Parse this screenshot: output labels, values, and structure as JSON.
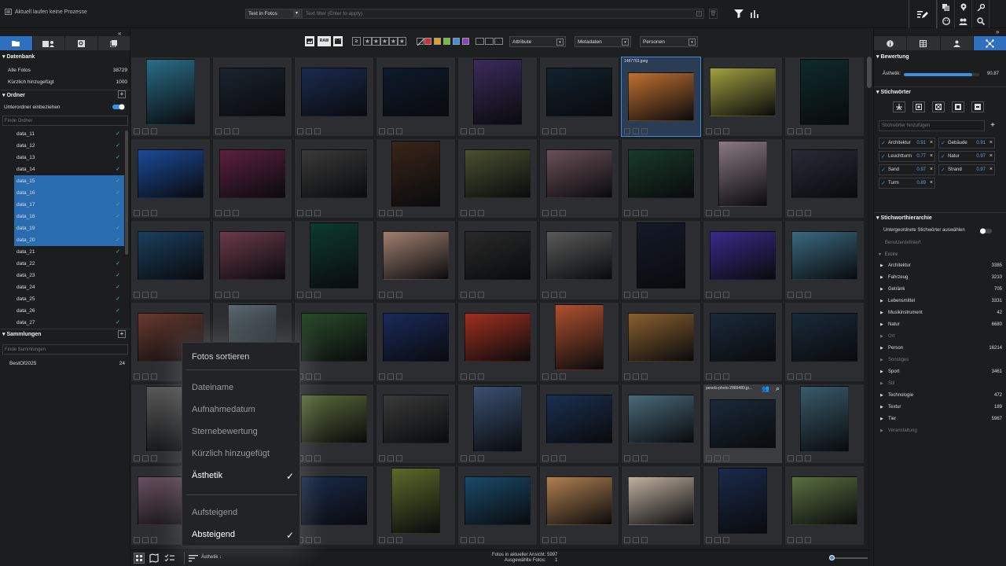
{
  "topbar": {
    "status": "Aktuell laufen keine Prozesse",
    "search_scope": "Text in Fotos",
    "search_placeholder": "Text filter (Enter to apply)"
  },
  "sidebar": {
    "database_title": "Datenbank",
    "all_photos_label": "Alle Fotos",
    "all_photos_count": "38729",
    "recent_label": "Kürzlich hinzugefügt",
    "recent_count": "1000",
    "folders_title": "Ordner",
    "include_subfolders": "Unterordner einbeziehen",
    "folder_search_placeholder": "Finde Ordner",
    "folders": [
      {
        "name": "data_11",
        "sel": false
      },
      {
        "name": "data_12",
        "sel": false
      },
      {
        "name": "data_13",
        "sel": false
      },
      {
        "name": "data_14",
        "sel": false
      },
      {
        "name": "data_15",
        "sel": true
      },
      {
        "name": "data_16",
        "sel": true
      },
      {
        "name": "data_17",
        "sel": true
      },
      {
        "name": "data_18",
        "sel": true
      },
      {
        "name": "data_19",
        "sel": true
      },
      {
        "name": "data_20",
        "sel": true
      },
      {
        "name": "data_21",
        "sel": false
      },
      {
        "name": "data_22",
        "sel": false
      },
      {
        "name": "data_23",
        "sel": false
      },
      {
        "name": "data_24",
        "sel": false
      },
      {
        "name": "data_25",
        "sel": false
      },
      {
        "name": "data_26",
        "sel": false
      },
      {
        "name": "data_27",
        "sel": false
      }
    ],
    "collections_title": "Sammlungen",
    "collection_search_placeholder": "Finde Sammlungen",
    "collection_name": "BestOf2025",
    "collection_count": "24"
  },
  "gridtoolbar": {
    "raw_label": "RAW",
    "gte_label": "≥",
    "attribute_label": "Attribute",
    "metadata_label": "Metadaten",
    "persons_label": "Personen",
    "color_labels": [
      "#d03030",
      "#e0a020",
      "#70c030",
      "#3a8fe0",
      "#8a40c0"
    ]
  },
  "grid": {
    "selected_caption": "1487763.jpeg",
    "hover_caption": "pexels-photo-2889489.jp..."
  },
  "bottombar": {
    "sort_label": "Ästhetik",
    "count_view_label": "Fotos in aktueller Ansicht:",
    "count_view": "5997",
    "count_selected_label": "Ausgewählte Fotos:",
    "count_selected": "1"
  },
  "rightpanel": {
    "rating_title": "Bewertung",
    "aesthetic_label": "Ästhetik:",
    "aesthetic_value": "90.87",
    "aesthetic_fraction": 0.9087,
    "keywords_title": "Stichwörter",
    "keyword_input_placeholder": "Stichwörter hinzufügen",
    "keywords": [
      {
        "name": "Architektur",
        "score": "0.91"
      },
      {
        "name": "Gebäude",
        "score": "0.91"
      },
      {
        "name": "Leuchtturm",
        "score": "0.77"
      },
      {
        "name": "Natur",
        "score": "0.97"
      },
      {
        "name": "Sand",
        "score": "0.97"
      },
      {
        "name": "Strand",
        "score": "0.97"
      },
      {
        "name": "Turm",
        "score": "0.89"
      }
    ],
    "hierarchy_title": "Stichworthierarchie",
    "show_sub_label": "Untergeordnete Stichwörter auswählen",
    "custom_label": "Benutzerdefiniert",
    "excire_label": "Excire",
    "hierarchy": [
      {
        "name": "Architektur",
        "count": "3385",
        "dim": false
      },
      {
        "name": "Fahrzeug",
        "count": "3210",
        "dim": false
      },
      {
        "name": "Getränk",
        "count": "705",
        "dim": false
      },
      {
        "name": "Lebensmittel",
        "count": "3331",
        "dim": false
      },
      {
        "name": "Musikinstrument",
        "count": "42",
        "dim": false
      },
      {
        "name": "Natur",
        "count": "6680",
        "dim": false
      },
      {
        "name": "Ort",
        "count": "",
        "dim": true
      },
      {
        "name": "Person",
        "count": "16214",
        "dim": false
      },
      {
        "name": "Sonstiges",
        "count": "",
        "dim": true
      },
      {
        "name": "Sport",
        "count": "3461",
        "dim": false
      },
      {
        "name": "Stil",
        "count": "",
        "dim": true
      },
      {
        "name": "Technologie",
        "count": "472",
        "dim": false
      },
      {
        "name": "Textur",
        "count": "189",
        "dim": false
      },
      {
        "name": "Tier",
        "count": "5967",
        "dim": false
      },
      {
        "name": "Veranstaltung",
        "count": "",
        "dim": true
      }
    ]
  },
  "sortmenu": {
    "title": "Fotos sortieren",
    "options": [
      {
        "label": "Dateiname",
        "checked": false
      },
      {
        "label": "Aufnahmedatum",
        "checked": false
      },
      {
        "label": "Sternebewertung",
        "checked": false
      },
      {
        "label": "Kürzlich hinzugefügt",
        "checked": false
      },
      {
        "label": "Ästhetik",
        "checked": true
      }
    ],
    "orders": [
      {
        "label": "Aufsteigend",
        "checked": false
      },
      {
        "label": "Absteigend",
        "checked": true
      }
    ]
  },
  "thumbs": [
    [
      "#2b6d88",
      "#1b2430",
      "#1a2b50",
      "#0e1b2c",
      "#3b2b5c",
      "#12222e",
      "#c07030",
      "#a0a040",
      "#0f2a2a"
    ],
    [
      "#1b4a9a",
      "#5b2040",
      "#3a3a3a",
      "#3a2518",
      "#4a5030",
      "#6a5058",
      "#1a3a2a",
      "#8a7a80",
      "#2a2a38"
    ],
    [
      "#1b3e5e",
      "#6b3a4a",
      "#0e3a2e",
      "#a08070",
      "#2a2a2a",
      "#5a5a5a",
      "#151a2a",
      "#3a2a8a",
      "#3a6a80"
    ],
    [
      "#6a3a30",
      "#5a6a70",
      "#2a4a2a",
      "#1a2a5a",
      "#a03020",
      "#b05030",
      "#8a6030",
      "#1a2a3a",
      "#1a2a3a"
    ],
    [
      "#5a5a5a",
      "#4a4a4a",
      "#5a6a3a",
      "#3a3a3a",
      "#3a5070",
      "#1a3050",
      "#4a6a7a",
      "#1a2a3a",
      "#3a5a6a"
    ],
    [
      "#6a5060",
      "#2a2a2a",
      "#1a2a4a",
      "#5a6a2a",
      "#1a4a6a",
      "#b08050",
      "#c0b0a0",
      "#1a2a4a",
      "#5a7040"
    ]
  ]
}
